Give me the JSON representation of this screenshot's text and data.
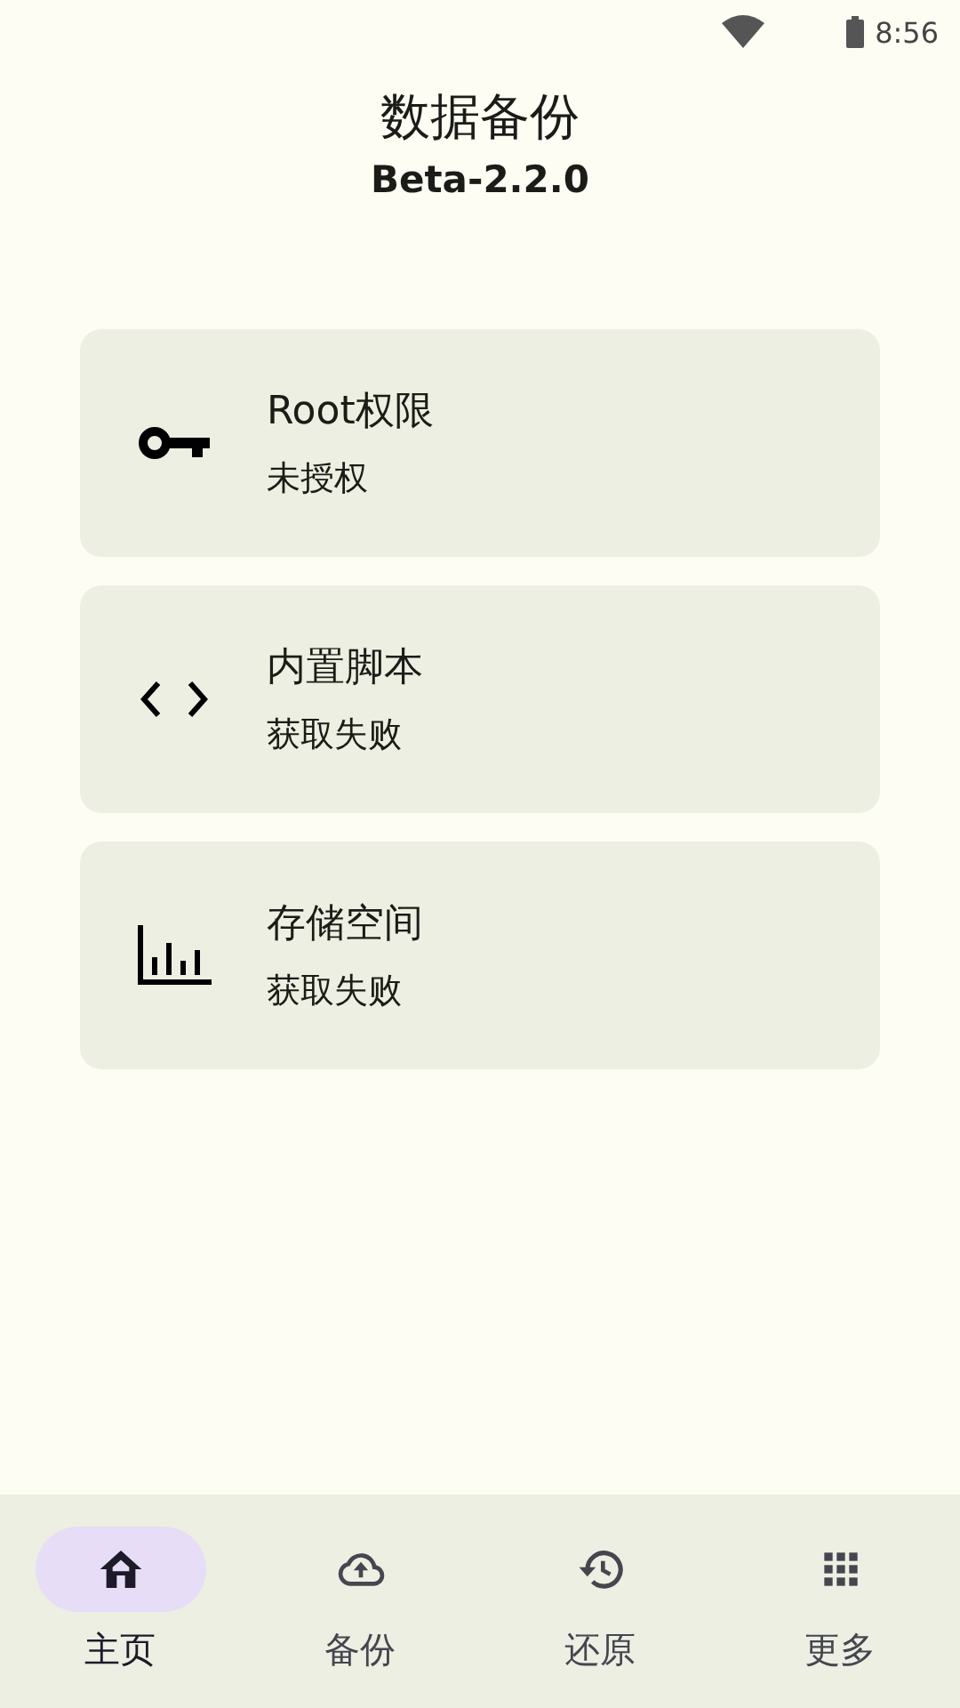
{
  "status_bar": {
    "time": "8:56"
  },
  "header": {
    "title": "数据备份",
    "version": "Beta-2.2.0"
  },
  "cards": [
    {
      "kind": "key",
      "title": "Root权限",
      "status": "未授权"
    },
    {
      "kind": "code",
      "title": "内置脚本",
      "status": "获取失败"
    },
    {
      "kind": "chart",
      "title": "存储空间",
      "status": "获取失败"
    }
  ],
  "bottom_nav": [
    {
      "kind": "home",
      "label": "主页",
      "selected": true
    },
    {
      "kind": "upload",
      "label": "备份",
      "selected": false
    },
    {
      "kind": "restore",
      "label": "还原",
      "selected": false
    },
    {
      "kind": "more",
      "label": "更多",
      "selected": false
    }
  ]
}
